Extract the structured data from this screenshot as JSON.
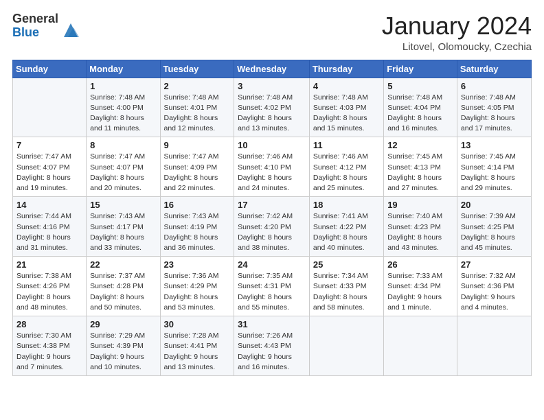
{
  "header": {
    "logo_general": "General",
    "logo_blue": "Blue",
    "month_title": "January 2024",
    "subtitle": "Litovel, Olomoucky, Czechia"
  },
  "days_of_week": [
    "Sunday",
    "Monday",
    "Tuesday",
    "Wednesday",
    "Thursday",
    "Friday",
    "Saturday"
  ],
  "weeks": [
    [
      {
        "day": "",
        "sunrise": "",
        "sunset": "",
        "daylight": ""
      },
      {
        "day": "1",
        "sunrise": "Sunrise: 7:48 AM",
        "sunset": "Sunset: 4:00 PM",
        "daylight": "Daylight: 8 hours and 11 minutes."
      },
      {
        "day": "2",
        "sunrise": "Sunrise: 7:48 AM",
        "sunset": "Sunset: 4:01 PM",
        "daylight": "Daylight: 8 hours and 12 minutes."
      },
      {
        "day": "3",
        "sunrise": "Sunrise: 7:48 AM",
        "sunset": "Sunset: 4:02 PM",
        "daylight": "Daylight: 8 hours and 13 minutes."
      },
      {
        "day": "4",
        "sunrise": "Sunrise: 7:48 AM",
        "sunset": "Sunset: 4:03 PM",
        "daylight": "Daylight: 8 hours and 15 minutes."
      },
      {
        "day": "5",
        "sunrise": "Sunrise: 7:48 AM",
        "sunset": "Sunset: 4:04 PM",
        "daylight": "Daylight: 8 hours and 16 minutes."
      },
      {
        "day": "6",
        "sunrise": "Sunrise: 7:48 AM",
        "sunset": "Sunset: 4:05 PM",
        "daylight": "Daylight: 8 hours and 17 minutes."
      }
    ],
    [
      {
        "day": "7",
        "sunrise": "Sunrise: 7:47 AM",
        "sunset": "Sunset: 4:07 PM",
        "daylight": "Daylight: 8 hours and 19 minutes."
      },
      {
        "day": "8",
        "sunrise": "Sunrise: 7:47 AM",
        "sunset": "Sunset: 4:07 PM",
        "daylight": "Daylight: 8 hours and 20 minutes."
      },
      {
        "day": "9",
        "sunrise": "Sunrise: 7:47 AM",
        "sunset": "Sunset: 4:09 PM",
        "daylight": "Daylight: 8 hours and 22 minutes."
      },
      {
        "day": "10",
        "sunrise": "Sunrise: 7:46 AM",
        "sunset": "Sunset: 4:10 PM",
        "daylight": "Daylight: 8 hours and 24 minutes."
      },
      {
        "day": "11",
        "sunrise": "Sunrise: 7:46 AM",
        "sunset": "Sunset: 4:12 PM",
        "daylight": "Daylight: 8 hours and 25 minutes."
      },
      {
        "day": "12",
        "sunrise": "Sunrise: 7:45 AM",
        "sunset": "Sunset: 4:13 PM",
        "daylight": "Daylight: 8 hours and 27 minutes."
      },
      {
        "day": "13",
        "sunrise": "Sunrise: 7:45 AM",
        "sunset": "Sunset: 4:14 PM",
        "daylight": "Daylight: 8 hours and 29 minutes."
      }
    ],
    [
      {
        "day": "14",
        "sunrise": "Sunrise: 7:44 AM",
        "sunset": "Sunset: 4:16 PM",
        "daylight": "Daylight: 8 hours and 31 minutes."
      },
      {
        "day": "15",
        "sunrise": "Sunrise: 7:43 AM",
        "sunset": "Sunset: 4:17 PM",
        "daylight": "Daylight: 8 hours and 33 minutes."
      },
      {
        "day": "16",
        "sunrise": "Sunrise: 7:43 AM",
        "sunset": "Sunset: 4:19 PM",
        "daylight": "Daylight: 8 hours and 36 minutes."
      },
      {
        "day": "17",
        "sunrise": "Sunrise: 7:42 AM",
        "sunset": "Sunset: 4:20 PM",
        "daylight": "Daylight: 8 hours and 38 minutes."
      },
      {
        "day": "18",
        "sunrise": "Sunrise: 7:41 AM",
        "sunset": "Sunset: 4:22 PM",
        "daylight": "Daylight: 8 hours and 40 minutes."
      },
      {
        "day": "19",
        "sunrise": "Sunrise: 7:40 AM",
        "sunset": "Sunset: 4:23 PM",
        "daylight": "Daylight: 8 hours and 43 minutes."
      },
      {
        "day": "20",
        "sunrise": "Sunrise: 7:39 AM",
        "sunset": "Sunset: 4:25 PM",
        "daylight": "Daylight: 8 hours and 45 minutes."
      }
    ],
    [
      {
        "day": "21",
        "sunrise": "Sunrise: 7:38 AM",
        "sunset": "Sunset: 4:26 PM",
        "daylight": "Daylight: 8 hours and 48 minutes."
      },
      {
        "day": "22",
        "sunrise": "Sunrise: 7:37 AM",
        "sunset": "Sunset: 4:28 PM",
        "daylight": "Daylight: 8 hours and 50 minutes."
      },
      {
        "day": "23",
        "sunrise": "Sunrise: 7:36 AM",
        "sunset": "Sunset: 4:29 PM",
        "daylight": "Daylight: 8 hours and 53 minutes."
      },
      {
        "day": "24",
        "sunrise": "Sunrise: 7:35 AM",
        "sunset": "Sunset: 4:31 PM",
        "daylight": "Daylight: 8 hours and 55 minutes."
      },
      {
        "day": "25",
        "sunrise": "Sunrise: 7:34 AM",
        "sunset": "Sunset: 4:33 PM",
        "daylight": "Daylight: 8 hours and 58 minutes."
      },
      {
        "day": "26",
        "sunrise": "Sunrise: 7:33 AM",
        "sunset": "Sunset: 4:34 PM",
        "daylight": "Daylight: 9 hours and 1 minute."
      },
      {
        "day": "27",
        "sunrise": "Sunrise: 7:32 AM",
        "sunset": "Sunset: 4:36 PM",
        "daylight": "Daylight: 9 hours and 4 minutes."
      }
    ],
    [
      {
        "day": "28",
        "sunrise": "Sunrise: 7:30 AM",
        "sunset": "Sunset: 4:38 PM",
        "daylight": "Daylight: 9 hours and 7 minutes."
      },
      {
        "day": "29",
        "sunrise": "Sunrise: 7:29 AM",
        "sunset": "Sunset: 4:39 PM",
        "daylight": "Daylight: 9 hours and 10 minutes."
      },
      {
        "day": "30",
        "sunrise": "Sunrise: 7:28 AM",
        "sunset": "Sunset: 4:41 PM",
        "daylight": "Daylight: 9 hours and 13 minutes."
      },
      {
        "day": "31",
        "sunrise": "Sunrise: 7:26 AM",
        "sunset": "Sunset: 4:43 PM",
        "daylight": "Daylight: 9 hours and 16 minutes."
      },
      {
        "day": "",
        "sunrise": "",
        "sunset": "",
        "daylight": ""
      },
      {
        "day": "",
        "sunrise": "",
        "sunset": "",
        "daylight": ""
      },
      {
        "day": "",
        "sunrise": "",
        "sunset": "",
        "daylight": ""
      }
    ]
  ]
}
